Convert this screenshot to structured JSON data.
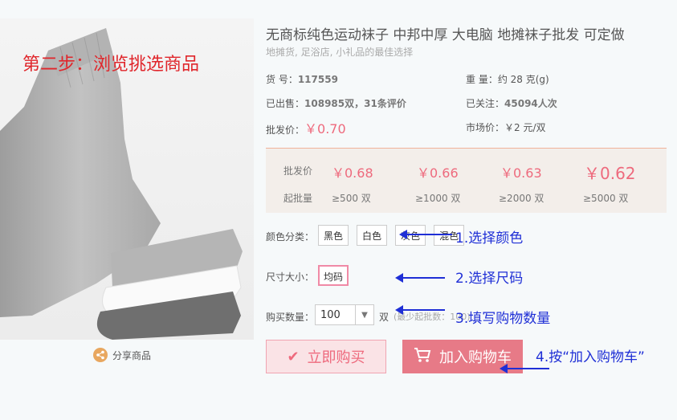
{
  "step_title": "第二步：浏览挑选商品",
  "share_label": "分享商品",
  "product": {
    "title": "无商标纯色运动袜子 中邦中厚 大电脑 地摊袜子批发 可定做",
    "subtitle": "地摊货, 足浴店, 小礼品的最佳选择",
    "sku_label": "货  号：",
    "sku_value": "117559",
    "weight_label": "重  量：",
    "weight_value": "约 28 克(g)",
    "sold_label": "已出售：",
    "sold_value": "108985双，31条评价",
    "followed_label": "已关注：",
    "followed_value": "45094人次",
    "wholesale_label": "批发价：",
    "wholesale_price": "￥0.70",
    "market_label": "市场价：",
    "market_price": "￥2 元/双"
  },
  "price_table": {
    "price_row_label": "批发价",
    "qty_row_label": "起批量",
    "tiers": [
      {
        "price": "￥0.68",
        "qty": "≥500 双"
      },
      {
        "price": "￥0.66",
        "qty": "≥1000 双"
      },
      {
        "price": "￥0.63",
        "qty": "≥2000 双"
      },
      {
        "price": "￥0.62",
        "qty": "≥5000 双"
      }
    ]
  },
  "options": {
    "color_label": "颜色分类：",
    "colors": [
      "黑色",
      "白色",
      "灰色",
      "混色"
    ],
    "size_label": "尺寸大小：",
    "sizes": [
      "均码"
    ],
    "qty_label": "购买数量：",
    "qty_value": "100",
    "qty_unit": "双",
    "qty_hint": "(最少起批数：100)"
  },
  "buttons": {
    "buy_now": "立即购买",
    "add_cart": "加入购物车"
  },
  "annotations": {
    "a1": "1.选择颜色",
    "a2": "2.选择尺码",
    "a3": "3.填写购物数量",
    "a4": "4.按“加入购物车”"
  },
  "colors": {
    "accent_red": "#ee6a7d",
    "annotation_blue": "#1f2fd6",
    "step_red": "#e0262b"
  }
}
